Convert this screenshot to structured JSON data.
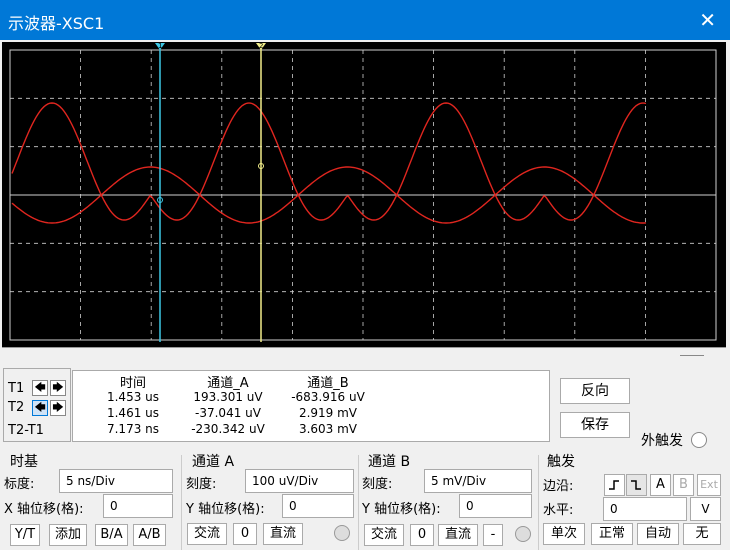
{
  "window": {
    "title": "示波器-XSC1",
    "close_glyph": "✕"
  },
  "cursors": {
    "t1_label": "T1",
    "t2_label": "T2",
    "diff_label": "T2-T1",
    "left_arrow": "🡄",
    "right_arrow": "🡆",
    "t1_marker": "1",
    "t2_marker": "2"
  },
  "readout": {
    "headers": [
      "时间",
      "通道_A",
      "通道_B"
    ],
    "rows": [
      [
        "1.453 us",
        "193.301 uV",
        "-683.916 uV"
      ],
      [
        "1.461 us",
        "-37.041 uV",
        "2.919 mV"
      ],
      [
        "7.173 ns",
        "-230.342 uV",
        "3.603 mV"
      ]
    ]
  },
  "side_buttons": {
    "reverse": "反向",
    "save": "保存",
    "ext_trigger": "外触发"
  },
  "timebase": {
    "title": "时基",
    "scale_label": "标度:",
    "scale_value": "5 ns/Div",
    "xpos_label": "X 轴位移(格):",
    "xpos_value": "0",
    "buttons": [
      "Y/T",
      "添加",
      "B/A",
      "A/B"
    ]
  },
  "channel_a": {
    "title": "通道 A",
    "scale_label": "刻度:",
    "scale_value": "100 uV/Div",
    "ypos_label": "Y 轴位移(格):",
    "ypos_value": "0",
    "buttons": [
      "交流",
      "0",
      "直流"
    ]
  },
  "channel_b": {
    "title": "通道 B",
    "scale_label": "刻度:",
    "scale_value": "5 mV/Div",
    "ypos_label": "Y 轴位移(格):",
    "ypos_value": "0",
    "buttons": [
      "交流",
      "0",
      "直流",
      "-"
    ]
  },
  "trigger": {
    "title": "触发",
    "edge_label": "边沿:",
    "level_label": "水平:",
    "level_value": "0",
    "level_unit": "V",
    "edge_buttons": [
      "A",
      "B",
      "Ext"
    ],
    "mode_buttons": [
      "单次",
      "正常",
      "自动",
      "无"
    ]
  },
  "colors": {
    "trace": "#e0261f",
    "cursor1": "#3ec8e6",
    "cursor2": "#f2ee8a",
    "grid": "#cfcfcf",
    "titlebar": "#0078d7"
  }
}
